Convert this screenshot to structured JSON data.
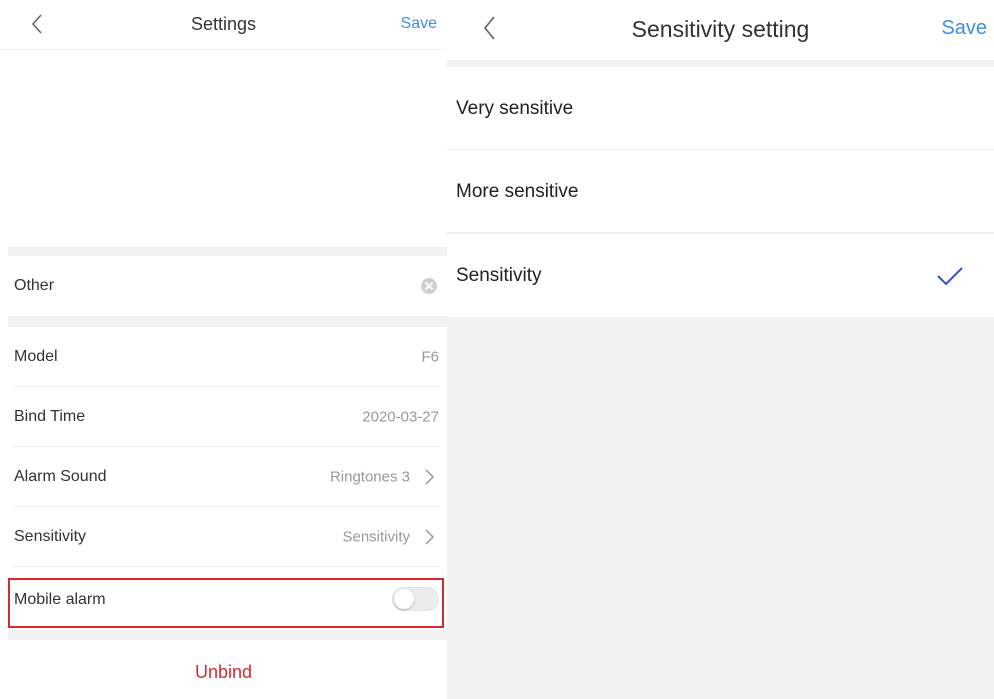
{
  "settings": {
    "title": "Settings",
    "save_label": "Save",
    "other_label": "Other",
    "rows": [
      {
        "label": "Model",
        "value": "F6"
      },
      {
        "label": "Bind Time",
        "value": "2020-03-27"
      },
      {
        "label": "Alarm Sound",
        "value": "Ringtones 3"
      },
      {
        "label": "Sensitivity",
        "value": "Sensitivity"
      }
    ],
    "mobile_alarm_label": "Mobile alarm",
    "mobile_alarm_on": false,
    "unbind_label": "Unbind"
  },
  "sensitivity": {
    "title": "Sensitivity setting",
    "save_label": "Save",
    "options": [
      {
        "label": "Very sensitive",
        "selected": false
      },
      {
        "label": "More sensitive",
        "selected": false
      },
      {
        "label": "Sensitivity",
        "selected": true
      }
    ]
  },
  "colors": {
    "accent": "#3d8fe0",
    "danger": "#d52b2b",
    "check": "#3a4fc2"
  },
  "icons": {
    "back": "chevron-left-icon",
    "clear": "clear-icon",
    "more": "chevron-right-icon",
    "selected": "checkmark-icon"
  }
}
